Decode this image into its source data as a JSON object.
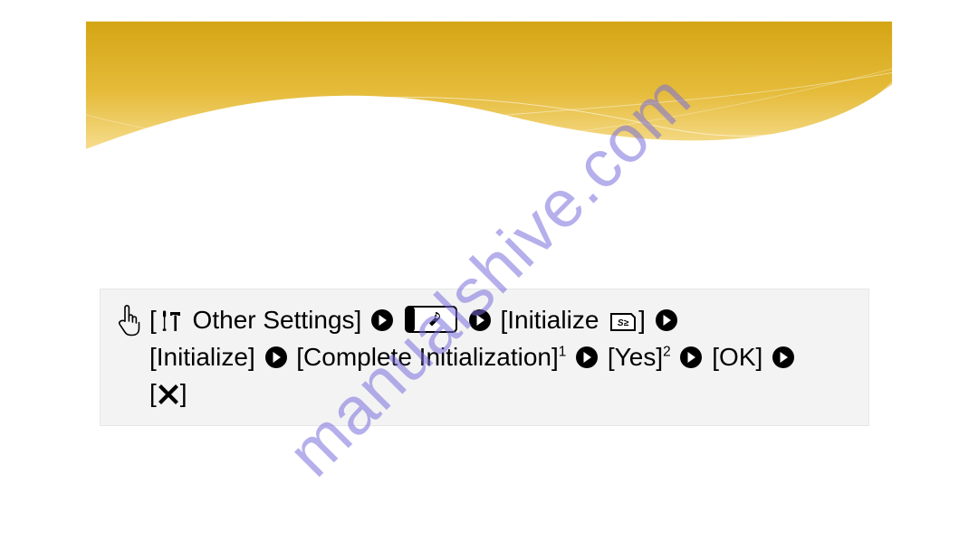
{
  "watermark": "manualshive.com",
  "box": {
    "step1_prefix": "[",
    "step1_label": " Other Settings]",
    "step3_prefix": "[Initialize ",
    "step3_suffix": "]",
    "step4": "[Initialize]",
    "step5_label": "[Complete Initialization]",
    "step5_sup": "1",
    "step6_label": "[Yes]",
    "step6_sup": "2",
    "step7": "[OK]",
    "step8_prefix": "[",
    "step8_suffix": "]"
  }
}
